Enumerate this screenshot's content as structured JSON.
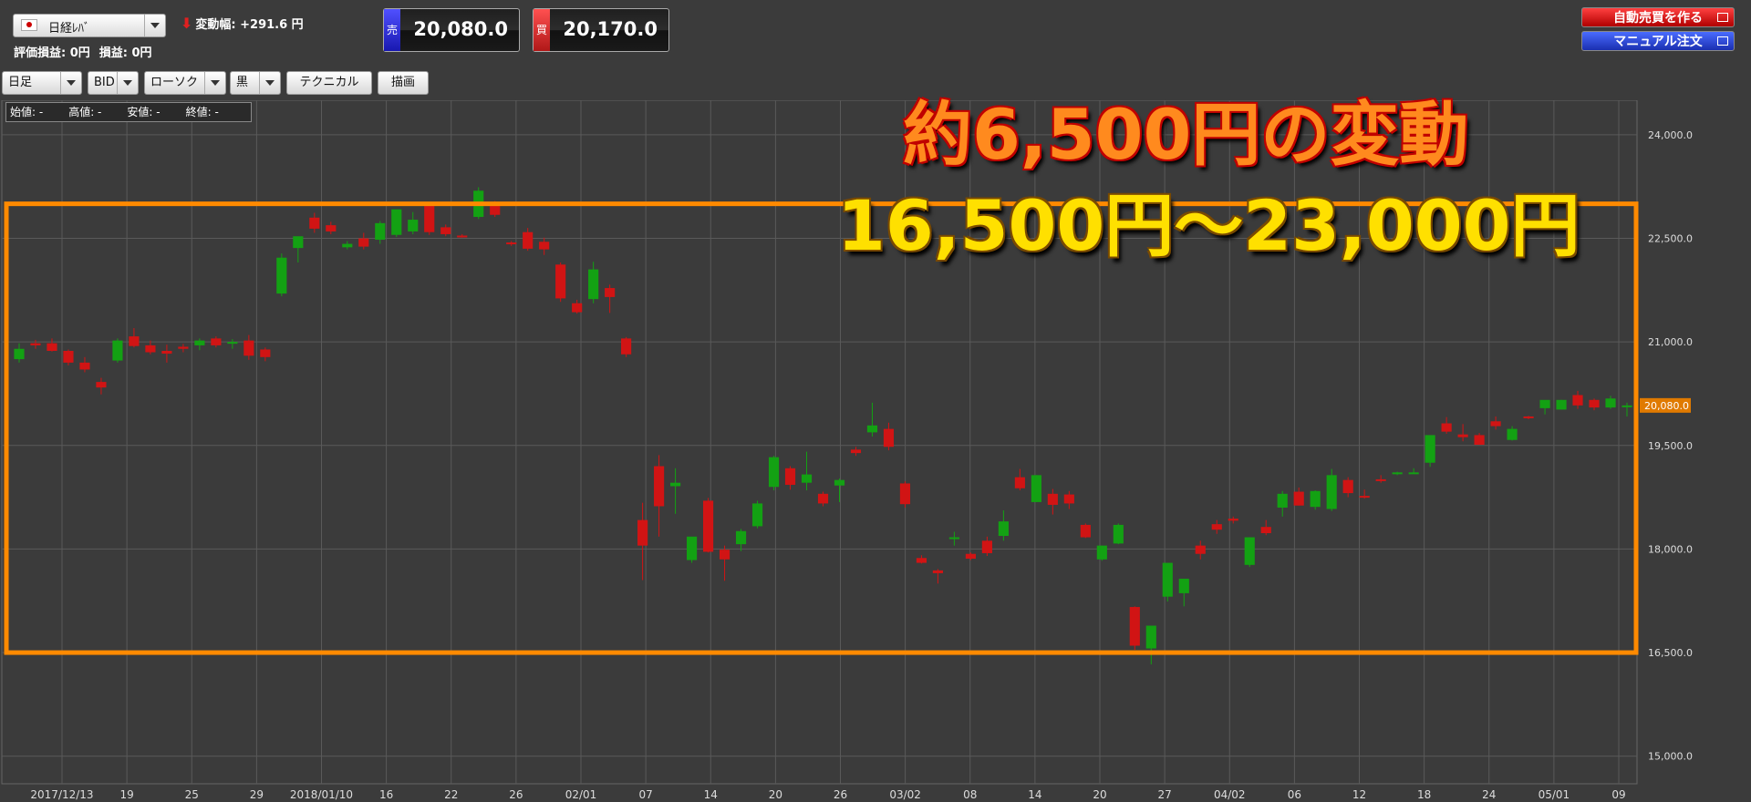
{
  "instrument": {
    "name": "日経ﾚﾊﾞ",
    "flag": "japan-flag-icon"
  },
  "change": {
    "label": "変動幅: +291.6 円"
  },
  "pnl": {
    "valuation": "評価損益: 0円",
    "profit": "損益: 0円"
  },
  "quotes": {
    "sell": {
      "tag": "売",
      "value": "20,080.0"
    },
    "buy": {
      "tag": "買",
      "value": "20,170.0"
    }
  },
  "order_buttons": {
    "auto": "自動売買を作る",
    "manual": "マニュアル注文"
  },
  "toolbar": {
    "period": "日足",
    "side": "BID",
    "chart_style": "ローソク",
    "theme": "黒",
    "technical": "テクニカル",
    "drawing": "描画"
  },
  "ohlc": {
    "open": "始値: -",
    "high": "高値: -",
    "low": "安値: -",
    "close": "終値: -"
  },
  "overlay": {
    "headline": "約6,500円の変動",
    "range": "16,500円～23,000円"
  },
  "colors": {
    "up": "#13a113",
    "down": "#d11414",
    "grid": "#5a5a5a",
    "highlight": "#ff8a00",
    "last_price": "#e07a00"
  },
  "chart_data": {
    "type": "candlestick",
    "y_ticks": [
      "24,000.0",
      "22,500.0",
      "21,000.0",
      "19,500.0",
      "18,000.0",
      "16,500.0",
      "15,000.0"
    ],
    "y_tick_values": [
      24000,
      22500,
      21000,
      19500,
      18000,
      16500,
      15000
    ],
    "ylim": [
      14600,
      24500
    ],
    "x_ticks": [
      "2017/12/13",
      "19",
      "25",
      "29",
      "2018/01/10",
      "16",
      "22",
      "26",
      "02/01",
      "07",
      "14",
      "20",
      "26",
      "03/02",
      "08",
      "14",
      "20",
      "27",
      "04/02",
      "06",
      "12",
      "18",
      "24",
      "05/01",
      "09"
    ],
    "last_price": {
      "label": "20,080.0",
      "value": 20080
    },
    "highlight_range": [
      16500,
      23000
    ],
    "candles": [
      [
        20750,
        20980,
        20700,
        20900
      ],
      [
        20980,
        21030,
        20900,
        20950
      ],
      [
        20980,
        21050,
        20860,
        20870
      ],
      [
        20870,
        20890,
        20660,
        20700
      ],
      [
        20700,
        20780,
        20560,
        20600
      ],
      [
        20420,
        20480,
        20240,
        20340
      ],
      [
        20730,
        21050,
        20700,
        21020
      ],
      [
        21080,
        21200,
        20920,
        20940
      ],
      [
        20950,
        21020,
        20820,
        20850
      ],
      [
        20870,
        20960,
        20700,
        20830
      ],
      [
        20930,
        20970,
        20850,
        20900
      ],
      [
        20950,
        21050,
        20880,
        21020
      ],
      [
        21050,
        21080,
        20920,
        20950
      ],
      [
        20980,
        21040,
        20900,
        21000
      ],
      [
        21020,
        21100,
        20740,
        20800
      ],
      [
        20890,
        20920,
        20720,
        20780
      ],
      [
        21700,
        22280,
        21660,
        22220
      ],
      [
        22360,
        22520,
        22150,
        22530
      ],
      [
        22800,
        22870,
        22580,
        22640
      ],
      [
        22690,
        22740,
        22560,
        22600
      ],
      [
        22370,
        22460,
        22340,
        22420
      ],
      [
        22500,
        22580,
        22340,
        22380
      ],
      [
        22480,
        22750,
        22420,
        22720
      ],
      [
        22550,
        22900,
        22520,
        22920
      ],
      [
        22600,
        22880,
        22560,
        22770
      ],
      [
        22980,
        23010,
        22550,
        22590
      ],
      [
        22660,
        22700,
        22530,
        22560
      ],
      [
        22540,
        22560,
        22510,
        22530
      ],
      [
        22810,
        23240,
        22780,
        23190
      ],
      [
        22990,
        23040,
        22810,
        22840
      ],
      [
        22440,
        22460,
        22390,
        22420
      ],
      [
        22590,
        22650,
        22320,
        22350
      ],
      [
        22450,
        22510,
        22260,
        22340
      ],
      [
        22120,
        22150,
        21580,
        21630
      ],
      [
        21560,
        21610,
        21410,
        21430
      ],
      [
        21620,
        22160,
        21560,
        22050
      ],
      [
        21780,
        21830,
        21420,
        21650
      ],
      [
        21050,
        21070,
        20780,
        20820
      ],
      [
        18420,
        18670,
        17550,
        18050
      ],
      [
        19200,
        19360,
        18180,
        18620
      ],
      [
        18910,
        19170,
        18510,
        18960
      ],
      [
        17840,
        18170,
        17800,
        18180
      ],
      [
        18700,
        18740,
        17950,
        17960
      ],
      [
        17990,
        18050,
        17540,
        17850
      ],
      [
        18070,
        18290,
        17970,
        18260
      ],
      [
        18330,
        18700,
        18300,
        18660
      ],
      [
        18900,
        19350,
        18850,
        19330
      ],
      [
        19170,
        19200,
        18860,
        18930
      ],
      [
        18960,
        19410,
        18850,
        19080
      ],
      [
        18800,
        18830,
        18620,
        18660
      ],
      [
        18920,
        19020,
        18680,
        19000
      ],
      [
        19440,
        19480,
        19350,
        19390
      ],
      [
        19690,
        20120,
        19630,
        19790
      ],
      [
        19740,
        19830,
        19430,
        19480
      ],
      [
        18950,
        18980,
        18600,
        18650
      ],
      [
        17870,
        17910,
        17790,
        17800
      ],
      [
        17690,
        17710,
        17500,
        17650
      ],
      [
        18150,
        18250,
        18050,
        18170
      ],
      [
        17930,
        17950,
        17840,
        17860
      ],
      [
        18120,
        18180,
        17900,
        17940
      ],
      [
        18190,
        18560,
        18120,
        18400
      ],
      [
        19040,
        19160,
        18850,
        18880
      ],
      [
        18680,
        19070,
        18680,
        19070
      ],
      [
        18800,
        18870,
        18500,
        18640
      ],
      [
        18790,
        18840,
        18580,
        18660
      ],
      [
        18350,
        18370,
        18160,
        18170
      ],
      [
        17850,
        18050,
        17830,
        18050
      ],
      [
        18080,
        18370,
        18070,
        18350
      ],
      [
        17160,
        17170,
        16540,
        16600
      ],
      [
        16560,
        16880,
        16330,
        16890
      ],
      [
        17310,
        17360,
        17240,
        17800
      ],
      [
        17360,
        17570,
        17170,
        17570
      ],
      [
        18050,
        18120,
        17850,
        17930
      ],
      [
        18360,
        18420,
        18220,
        18280
      ],
      [
        18440,
        18470,
        18370,
        18410
      ],
      [
        17770,
        18170,
        17740,
        18170
      ],
      [
        18320,
        18420,
        18200,
        18230
      ],
      [
        18600,
        18840,
        18470,
        18800
      ],
      [
        18830,
        18890,
        18630,
        18630
      ],
      [
        18610,
        18850,
        18570,
        18840
      ],
      [
        18580,
        19160,
        18550,
        19070
      ],
      [
        19000,
        19040,
        18750,
        18810
      ],
      [
        18770,
        18860,
        18730,
        18750
      ],
      [
        19010,
        19070,
        18960,
        19000
      ],
      [
        19090,
        19120,
        19070,
        19110
      ],
      [
        19100,
        19170,
        19090,
        19110
      ],
      [
        19250,
        19620,
        19190,
        19650
      ],
      [
        19820,
        19910,
        19670,
        19700
      ],
      [
        19660,
        19810,
        19560,
        19620
      ],
      [
        19650,
        19680,
        19510,
        19510
      ],
      [
        19850,
        19920,
        19730,
        19780
      ],
      [
        19580,
        19780,
        19570,
        19740
      ],
      [
        19920,
        19930,
        19880,
        19900
      ],
      [
        20040,
        20080,
        19950,
        20160
      ],
      [
        20020,
        20160,
        20020,
        20160
      ],
      [
        20230,
        20290,
        20030,
        20080
      ],
      [
        20160,
        20180,
        20010,
        20050
      ],
      [
        20050,
        20220,
        20030,
        20180
      ],
      [
        20080,
        20120,
        19920,
        20080
      ]
    ]
  }
}
